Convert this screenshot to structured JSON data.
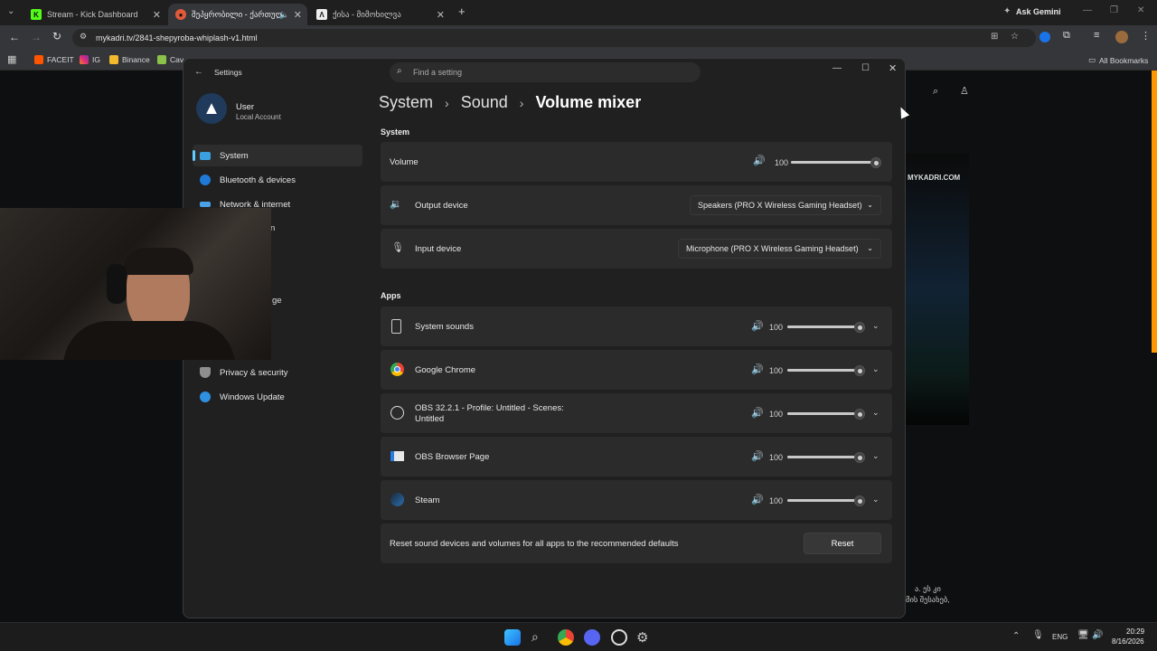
{
  "browser": {
    "tabs": [
      {
        "label": "Stream - Kick Dashboard",
        "active": false
      },
      {
        "label": "შეპყრობილი - ქართულ...",
        "active": true
      },
      {
        "label": "ქისა - მიმოხილვა",
        "active": false
      }
    ],
    "new_tab": "+",
    "ask_gemini": "Ask Gemini",
    "url": "mykadri.tv/2841-shepyroba-whiplash-v1.html",
    "bookmarks": [
      "FACEIT",
      "IG",
      "Binance",
      "Cav"
    ],
    "all_bookmarks": "All Bookmarks"
  },
  "page": {
    "site_banner": "MYKADRI.COM",
    "bottom_text_1": "ა. ეს კი",
    "bottom_text_2": "მის შესახებ,"
  },
  "settings": {
    "app_title": "Settings",
    "search_placeholder": "Find a setting",
    "user": {
      "name": "User",
      "account": "Local Account"
    },
    "nav": [
      {
        "label": "System",
        "icon": "monitor-icon",
        "selected": true
      },
      {
        "label": "Bluetooth & devices",
        "icon": "bluetooth-icon"
      },
      {
        "label": "Network & internet",
        "icon": "wifi-icon"
      },
      {
        "label": "Privacy & security",
        "icon": "shield-icon"
      },
      {
        "label": "Windows Update",
        "icon": "update-icon"
      }
    ],
    "nav_partial": [
      "n",
      "ge"
    ],
    "breadcrumb": {
      "level1": "System",
      "level2": "Sound",
      "level3": "Volume mixer",
      "sep": "›"
    },
    "system_section": {
      "header": "System",
      "volume_label": "Volume",
      "volume_value": "100",
      "volume_level": 100,
      "output_label": "Output device",
      "output_value": "Speakers (PRO X Wireless Gaming Headset)",
      "input_label": "Input device",
      "input_value": "Microphone (PRO X Wireless Gaming Headset)"
    },
    "apps_section": {
      "header": "Apps",
      "apps": [
        {
          "name": "System sounds",
          "volume": "100",
          "level": 100,
          "icon": "speaker-box-icon"
        },
        {
          "name": "Google Chrome",
          "volume": "100",
          "level": 100,
          "icon": "chrome-icon"
        },
        {
          "name": "OBS 32.2.1 - Profile: Untitled - Scenes: Untitled",
          "volume": "100",
          "level": 100,
          "icon": "obs-icon"
        },
        {
          "name": "OBS Browser Page",
          "volume": "100",
          "level": 100,
          "icon": "browser-page-icon"
        },
        {
          "name": "Steam",
          "volume": "100",
          "level": 100,
          "icon": "steam-icon"
        }
      ]
    },
    "reset_text": "Reset sound devices and volumes for all apps to the recommended defaults",
    "reset_button": "Reset"
  },
  "taskbar": {
    "language": "ENG",
    "time": "20:29",
    "date": "8/16/2026"
  },
  "colors": {
    "accent": "#60cdff",
    "window_bg": "#202020",
    "card_bg": "#2b2b2b"
  }
}
